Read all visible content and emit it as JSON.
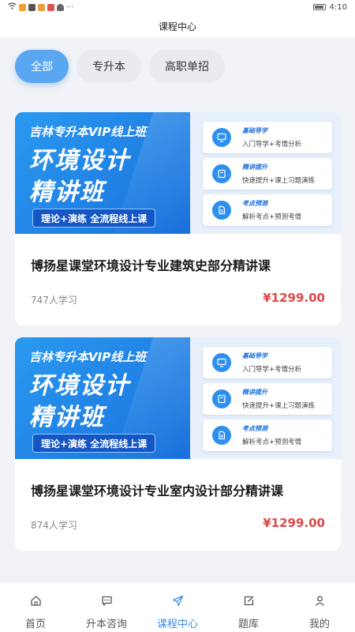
{
  "status_bar": {
    "time": "4:10"
  },
  "header": {
    "title": "课程中心"
  },
  "filters": [
    {
      "label": "全部",
      "active": true
    },
    {
      "label": "专升本",
      "active": false
    },
    {
      "label": "高职单招",
      "active": false
    }
  ],
  "courses": [
    {
      "banner": {
        "tag": "吉林专升本VIP线上班",
        "title_line1": "环境设计",
        "title_line2": "精讲班",
        "pill": "理论+演练  全流程线上课",
        "features": [
          {
            "title": "基础导学",
            "desc": "入门导学+考情分析",
            "icon": "monitor-icon"
          },
          {
            "title": "精讲提升",
            "desc": "快速提升+课上习题演练",
            "icon": "book-icon"
          },
          {
            "title": "考点预测",
            "desc": "解析考点+预测考情",
            "icon": "document-icon"
          }
        ]
      },
      "title": "博扬星课堂环境设计专业建筑史部分精讲课",
      "learners": "747人学习",
      "price": "¥1299.00"
    },
    {
      "banner": {
        "tag": "吉林专升本VIP线上班",
        "title_line1": "环境设计",
        "title_line2": "精讲班",
        "pill": "理论+演练  全流程线上课",
        "features": [
          {
            "title": "基础导学",
            "desc": "入门导学+考情分析",
            "icon": "monitor-icon"
          },
          {
            "title": "精讲提升",
            "desc": "快速提升+课上习题演练",
            "icon": "book-icon"
          },
          {
            "title": "考点预测",
            "desc": "解析考点+预测考情",
            "icon": "document-icon"
          }
        ]
      },
      "title": "博扬星课堂环境设计专业室内设计部分精讲课",
      "learners": "874人学习",
      "price": "¥1299.00"
    }
  ],
  "tabbar": [
    {
      "label": "首页",
      "icon": "home-icon",
      "active": false
    },
    {
      "label": "升本咨询",
      "icon": "chat-icon",
      "active": false
    },
    {
      "label": "课程中心",
      "icon": "send-icon",
      "active": true
    },
    {
      "label": "题库",
      "icon": "edit-icon",
      "active": false
    },
    {
      "label": "我的",
      "icon": "user-icon",
      "active": false
    }
  ],
  "colors": {
    "accent": "#3d8fe6",
    "price": "#e04848",
    "chip_active": "#5aa6f1"
  }
}
